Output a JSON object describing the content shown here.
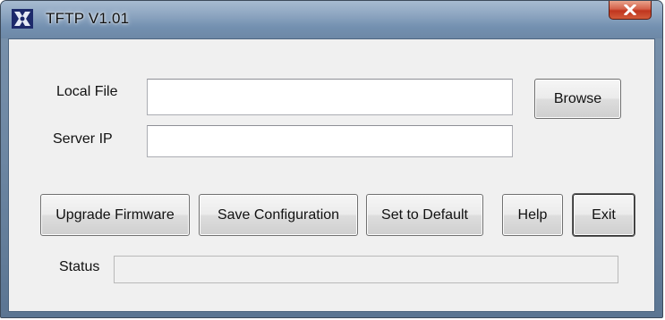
{
  "window": {
    "title": "TFTP V1.01",
    "icon": "tftp-app-icon",
    "close_icon": "close-x-icon"
  },
  "form": {
    "local_file_label": "Local File",
    "local_file_value": "",
    "server_ip_label": "Server IP",
    "server_ip_value": ""
  },
  "buttons": {
    "browse": "Browse",
    "upgrade_firmware": "Upgrade Firmware",
    "save_configuration": "Save Configuration",
    "set_to_default": "Set to Default",
    "help": "Help",
    "exit": "Exit"
  },
  "status": {
    "label": "Status",
    "value": ""
  },
  "colors": {
    "close_button": "#c9452a",
    "dialog_background": "#f0f0f0",
    "frame": "#6d88a6"
  }
}
